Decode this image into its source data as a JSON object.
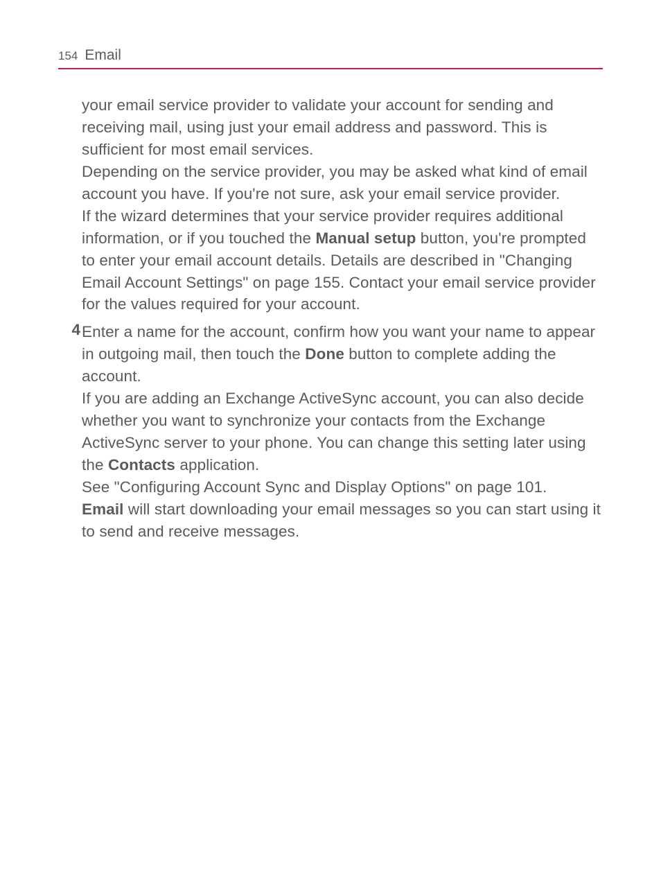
{
  "header": {
    "pageNumber": "154",
    "sectionTitle": "Email"
  },
  "body": {
    "p1": "your email service provider to validate your account for sending and receiving mail, using just your email address and password. This is sufficient for most email services.",
    "p2": "Depending on the service provider, you may be asked what kind of email account you have. If you're not sure, ask your email service provider.",
    "p3_part1": "If the wizard determines that your service provider requires additional information, or if you touched the ",
    "p3_bold1": "Manual setup",
    "p3_part2": " button, you're prompted to enter your email account details. Details are described in \"Changing Email Account Settings\" on page 155. Contact your email service provider for the values required for your account.",
    "step4_num": "4",
    "step4_p1_part1": "Enter a name for the account, confirm how you want your name to appear in outgoing mail, then touch the ",
    "step4_p1_bold1": "Done",
    "step4_p1_part2": " button to complete adding the account.",
    "step4_p2_part1": "If you are adding an Exchange ActiveSync account, you can also decide whether you want to synchronize your contacts from the Exchange ActiveSync server to your phone. You can change this setting later using the ",
    "step4_p2_bold1": "Contacts",
    "step4_p2_part2": " application.",
    "step4_p3": "See \"Configuring Account Sync and Display Options\" on page 101.",
    "step4_p4_bold1": "Email",
    "step4_p4_part2": " will start downloading your email messages so you can start using it to send and receive messages."
  }
}
